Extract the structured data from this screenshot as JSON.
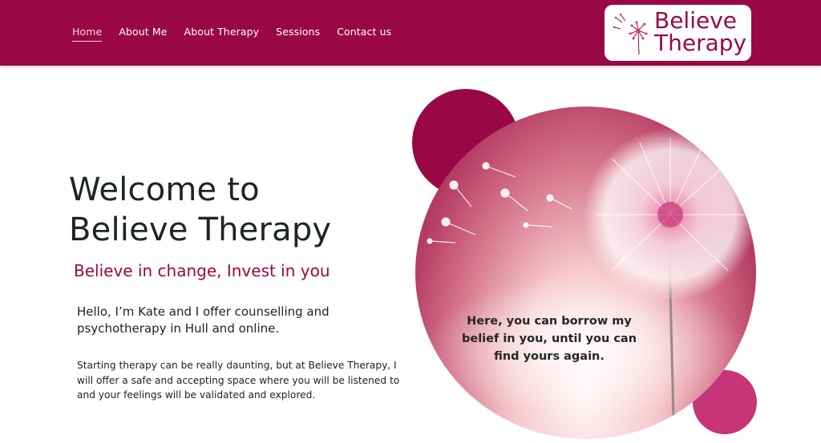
{
  "nav": {
    "items": [
      {
        "label": "Home",
        "active": true
      },
      {
        "label": "About Me",
        "active": false
      },
      {
        "label": "About Therapy",
        "active": false
      },
      {
        "label": "Sessions",
        "active": false
      },
      {
        "label": "Contact us",
        "active": false
      }
    ]
  },
  "logo": {
    "line1": "Believe",
    "line2": "Therapy",
    "icon": "dandelion-icon"
  },
  "hero": {
    "title_line1": "Welcome to",
    "title_line2": "Believe Therapy",
    "tagline": "Believe in change, Invest in you",
    "intro": "Hello, I’m Kate and I offer counselling and psychotherapy in Hull and online.",
    "body": "Starting therapy can be really daunting, but at Believe Therapy, I will offer a safe and accepting space where you will be listened to and your feelings will be validated and explored.",
    "quote": "Here, you can borrow my belief in you, until you can find yours again.",
    "image": "dandelion-image"
  },
  "colors": {
    "brand": "#990845",
    "accent_pink": "#c73478",
    "text_dark": "#1d2620",
    "header_bg": "#990845"
  }
}
